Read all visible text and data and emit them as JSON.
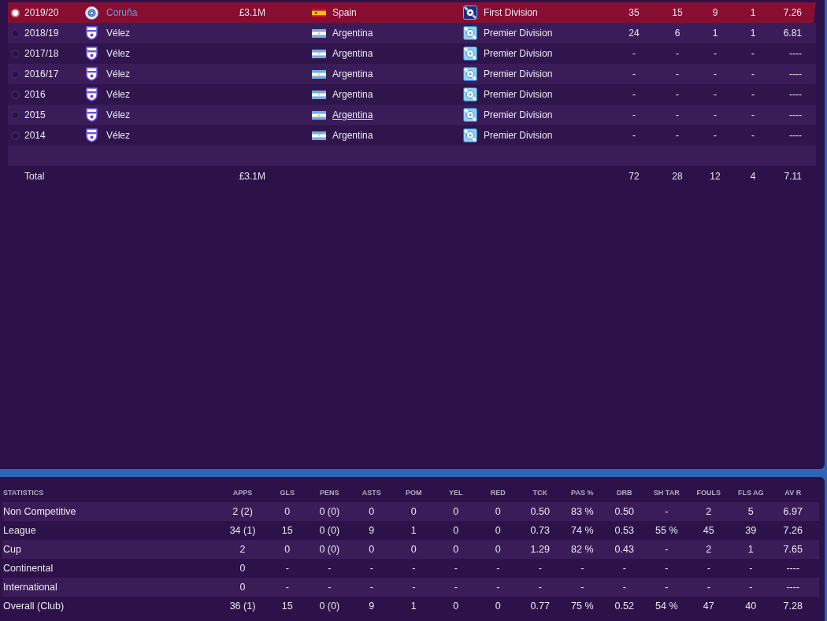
{
  "career_table": {
    "rows": [
      {
        "selected": true,
        "season": "2019/20",
        "club": {
          "name": "Coruña",
          "kind": "round",
          "highlighted": true
        },
        "value": "£3.1M",
        "nation": {
          "name": "Spain",
          "kind": "red-yellow",
          "hovered": false
        },
        "division": {
          "name": "First Division",
          "kind": "dark"
        },
        "stats": [
          "35",
          "15",
          "9",
          "1",
          "7.26"
        ]
      },
      {
        "selected": false,
        "season": "2018/19",
        "club": {
          "name": "Vélez",
          "kind": "shield",
          "highlighted": false
        },
        "nation": {
          "name": "Argentina",
          "kind": "blue-white",
          "hovered": false
        },
        "division": {
          "name": "Premier Division",
          "kind": "light"
        },
        "stats": [
          "24",
          "6",
          "1",
          "1",
          "6.81"
        ]
      },
      {
        "selected": false,
        "season": "2017/18",
        "club": {
          "name": "Vélez",
          "kind": "shield",
          "highlighted": false
        },
        "nation": {
          "name": "Argentina",
          "kind": "blue-white",
          "hovered": false
        },
        "division": {
          "name": "Premier Division",
          "kind": "light"
        },
        "stats": [
          "-",
          "-",
          "-",
          "-",
          "----"
        ]
      },
      {
        "selected": false,
        "season": "2016/17",
        "club": {
          "name": "Vélez",
          "kind": "shield",
          "highlighted": false
        },
        "nation": {
          "name": "Argentina",
          "kind": "blue-white",
          "hovered": false
        },
        "division": {
          "name": "Premier Division",
          "kind": "light"
        },
        "stats": [
          "-",
          "-",
          "-",
          "-",
          "----"
        ]
      },
      {
        "selected": false,
        "season": "2016",
        "club": {
          "name": "Vélez",
          "kind": "shield",
          "highlighted": false
        },
        "nation": {
          "name": "Argentina",
          "kind": "blue-white",
          "hovered": false
        },
        "division": {
          "name": "Premier Division",
          "kind": "light"
        },
        "stats": [
          "-",
          "-",
          "-",
          "-",
          "----"
        ]
      },
      {
        "selected": false,
        "season": "2015",
        "club": {
          "name": "Vélez",
          "kind": "shield",
          "highlighted": false
        },
        "nation": {
          "name": "Argentina",
          "kind": "blue-white",
          "hovered": true
        },
        "division": {
          "name": "Premier Division",
          "kind": "light"
        },
        "stats": [
          "-",
          "-",
          "-",
          "-",
          "----"
        ]
      },
      {
        "selected": false,
        "season": "2014",
        "club": {
          "name": "Vélez",
          "kind": "shield",
          "highlighted": false
        },
        "nation": {
          "name": "Argentina",
          "kind": "blue-white",
          "hovered": false
        },
        "division": {
          "name": "Premier Division",
          "kind": "light"
        },
        "stats": [
          "-",
          "-",
          "-",
          "-",
          "----"
        ]
      }
    ],
    "total": {
      "label": "Total",
      "value": "£3.1M",
      "stats": [
        "72",
        "28",
        "12",
        "4",
        "7.11"
      ]
    }
  },
  "statistics_table": {
    "columns": [
      "STATISTICS",
      "APPS",
      "GLS",
      "PENS",
      "ASTS",
      "POM",
      "YEL",
      "RED",
      "TCK",
      "PAS %",
      "DRB",
      "SH TAR",
      "FOULS",
      "FLS AG",
      "AV R"
    ],
    "rows": [
      {
        "cells": [
          "Non Competitive",
          "2 (2)",
          "0",
          "0 (0)",
          "0",
          "0",
          "0",
          "0",
          "0.50",
          "83 %",
          "0.50",
          "-",
          "2",
          "5",
          "6.97"
        ]
      },
      {
        "cells": [
          "League",
          "34 (1)",
          "15",
          "0 (0)",
          "9",
          "1",
          "0",
          "0",
          "0.73",
          "74 %",
          "0.53",
          "55 %",
          "45",
          "39",
          "7.26"
        ]
      },
      {
        "cells": [
          "Cup",
          "2",
          "0",
          "0 (0)",
          "0",
          "0",
          "0",
          "0",
          "1.29",
          "82 %",
          "0.43",
          "-",
          "2",
          "1",
          "7.65"
        ]
      },
      {
        "cells": [
          "Continental",
          "0",
          "-",
          "-",
          "-",
          "-",
          "-",
          "-",
          "-",
          "-",
          "-",
          "-",
          "-",
          "-",
          "----"
        ]
      },
      {
        "cells": [
          "International",
          "0",
          "-",
          "-",
          "-",
          "-",
          "-",
          "-",
          "-",
          "-",
          "-",
          "-",
          "-",
          "-",
          "----"
        ]
      },
      {
        "cells": [
          "Overall (Club)",
          "36 (1)",
          "15",
          "0 (0)",
          "9",
          "1",
          "0",
          "0",
          "0.77",
          "75 %",
          "0.52",
          "54 %",
          "47",
          "40",
          "7.28"
        ]
      }
    ]
  }
}
